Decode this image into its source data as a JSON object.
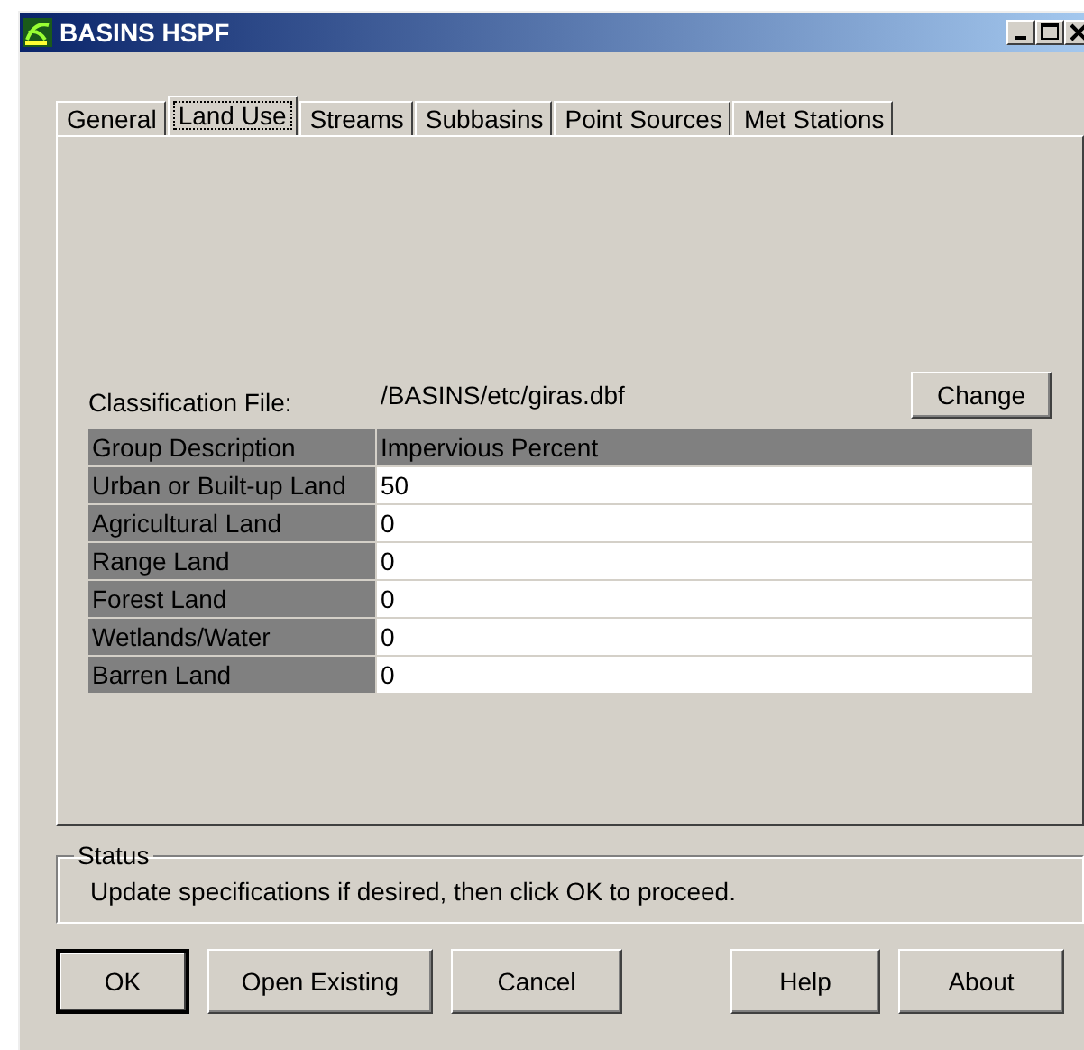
{
  "window": {
    "title": "BASINS HSPF"
  },
  "tabs": [
    {
      "label": "General",
      "selected": false
    },
    {
      "label": "Land Use",
      "selected": true
    },
    {
      "label": "Streams",
      "selected": false
    },
    {
      "label": "Subbasins",
      "selected": false
    },
    {
      "label": "Point Sources",
      "selected": false
    },
    {
      "label": "Met Stations",
      "selected": false
    }
  ],
  "classification": {
    "label": "Classification File:",
    "value": "/BASINS/etc/giras.dbf",
    "button": "Change"
  },
  "table": {
    "columns": [
      "Group Description",
      "Impervious Percent"
    ],
    "rows": [
      [
        "Urban or Built-up Land",
        "50"
      ],
      [
        "Agricultural Land",
        "0"
      ],
      [
        "Range Land",
        "0"
      ],
      [
        "Forest Land",
        "0"
      ],
      [
        "Wetlands/Water",
        "0"
      ],
      [
        "Barren Land",
        "0"
      ]
    ]
  },
  "status": {
    "title": "Status",
    "message": "Update specifications if desired, then click OK to proceed."
  },
  "buttons": [
    {
      "label": "OK",
      "default": true
    },
    {
      "label": "Open Existing",
      "default": false
    },
    {
      "label": "Cancel",
      "default": false
    },
    {
      "label": "Help",
      "default": false
    },
    {
      "label": "About",
      "default": false
    }
  ]
}
